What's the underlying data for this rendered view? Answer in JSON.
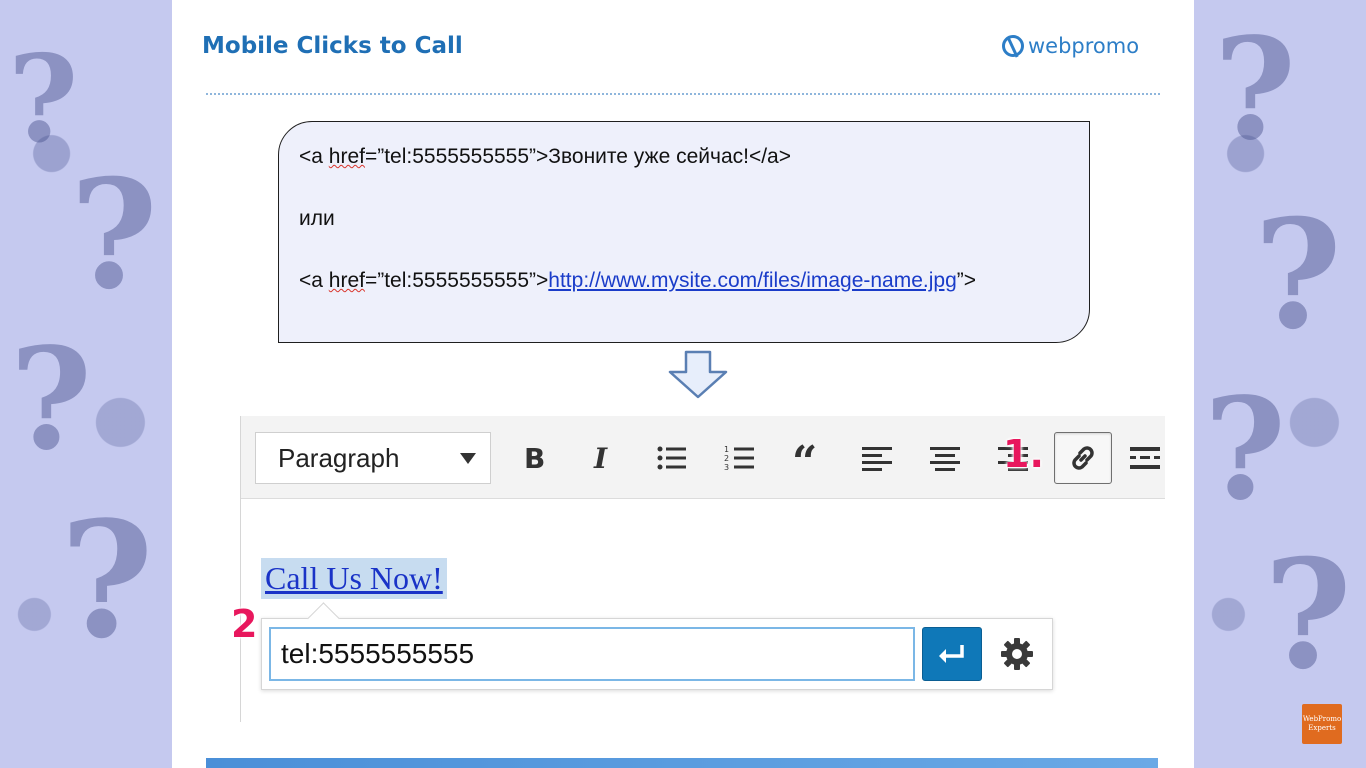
{
  "slide": {
    "title": "Mobile Clicks to Call",
    "logo_text": "webpromo"
  },
  "code": {
    "line1_pre": "<a ",
    "line1_attr": "href",
    "line1_post": "=”tel:5555555555”>Звоните уже сейчас!</a>",
    "or_text": "или",
    "line3_pre": "<a ",
    "line3_attr": "href",
    "line3_mid": "=”tel:5555555555”>",
    "line3_link": "http://www.mysite.com/files/image-name.jpg",
    "line3_post": "”>"
  },
  "editor": {
    "format_select": "Paragraph",
    "toolbar_buttons": [
      "bold",
      "italic",
      "bulleted-list",
      "numbered-list",
      "blockquote",
      "align-left",
      "align-center",
      "align-right",
      "insert-link",
      "read-more"
    ],
    "step1_label": "1.",
    "step2_label": "2.",
    "content_link_text": "Call Us Now!",
    "link_input_value": "tel:5555555555"
  },
  "badge": {
    "line1": "WebPromo",
    "line2": "Experts"
  },
  "colors": {
    "title": "#1f6fb5",
    "step_label": "#e8175d",
    "apply_button": "#0f78b8",
    "link": "#1a33c7"
  }
}
